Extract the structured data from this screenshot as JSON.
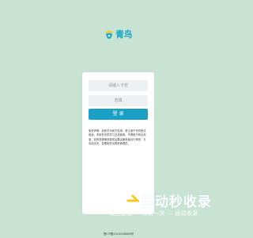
{
  "header": {
    "logo_text": "青鸟",
    "logo_icon": "bird-icon"
  },
  "login_form": {
    "username_placeholder": "请输入卡密",
    "captcha_placeholder": "选填",
    "login_label": "登 录",
    "notice": "免责声明：此软件为我方自用，禁止用于任何违法用途，本软件仅供学习交流使用，不得用于商业用途，如有违规使用造成后果由使用者自行承担，与本站无关，如需相关请联系管理员。"
  },
  "watermark": {
    "title": "自动秒收录",
    "subtitle": "做上链接 — 来访一次 — 自动收录"
  },
  "footer": {
    "icp": "晋ICP备2024008888号"
  },
  "colors": {
    "background": "#c9e3d2",
    "accent": "#1aa0c5"
  }
}
